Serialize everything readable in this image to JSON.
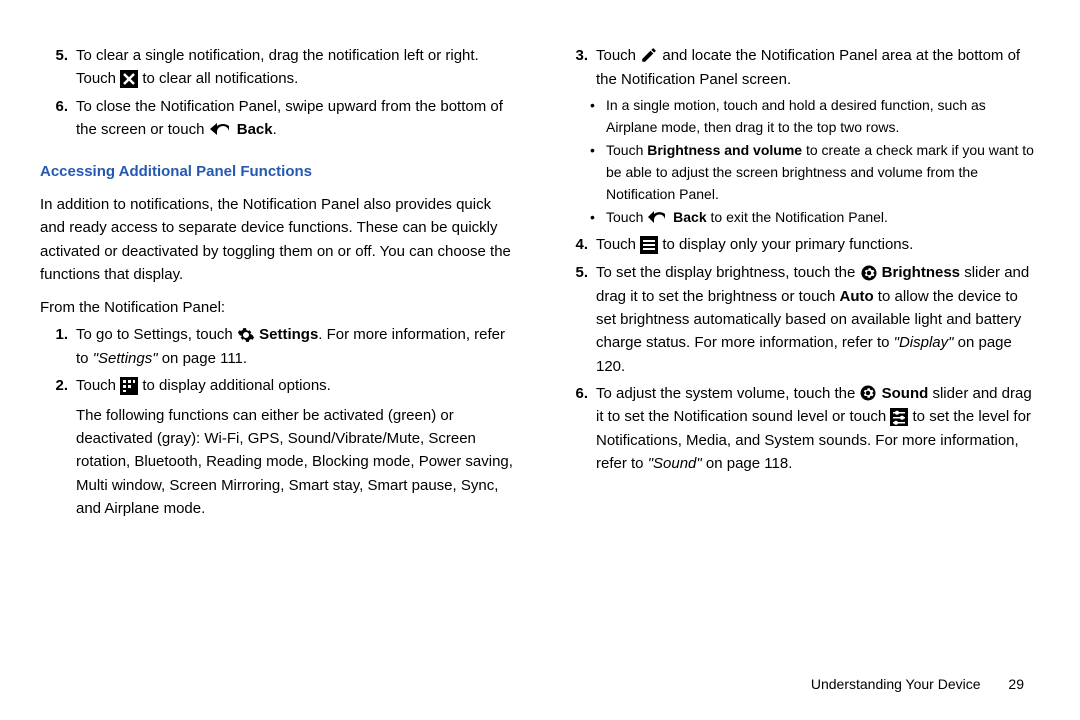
{
  "left": {
    "item5": {
      "num": "5.",
      "text_a": "To clear a single notification, drag the notification left or right. Touch ",
      "text_b": " to clear all notifications."
    },
    "item6": {
      "num": "6.",
      "text_a": "To close the Notification Panel, swipe upward from the bottom of the screen or touch ",
      "back": "Back",
      "text_b": "."
    },
    "heading": "Accessing Additional Panel Functions",
    "intro": "In addition to notifications, the Notification Panel also provides quick and ready access to separate device functions. These can be quickly activated or deactivated by toggling them on or off. You can choose the functions that display.",
    "from": "From the Notification Panel:",
    "s1": {
      "num": "1.",
      "a": "To go to Settings, touch ",
      "settings": "Settings",
      "b": ". For more information, refer to ",
      "ref": "\"Settings\"",
      "c": " on page 111."
    },
    "s2": {
      "num": "2.",
      "a": "Touch ",
      "b": " to display additional options.",
      "follow": "The following functions can either be activated (green) or deactivated (gray): Wi-Fi, GPS, Sound/Vibrate/Mute, Screen rotation, Bluetooth, Reading mode, Blocking mode, Power saving, Multi window, Screen Mirroring, Smart stay, Smart pause, Sync, and Airplane mode."
    }
  },
  "right": {
    "s3": {
      "num": "3.",
      "a": "Touch ",
      "b": " and locate the Notification Panel area at the bottom of the Notification Panel screen."
    },
    "b1": "In a single motion, touch and hold a desired function, such as Airplane mode, then drag it to the top two rows.",
    "b2a": "Touch ",
    "b2bold": "Brightness and volume",
    "b2b": " to create a check mark if you want to be able to adjust the screen brightness and volume from the Notification Panel.",
    "b3a": "Touch ",
    "b3back": "Back",
    "b3b": " to exit the Notification Panel.",
    "s4": {
      "num": "4.",
      "a": "Touch ",
      "b": " to display only your primary functions."
    },
    "s5": {
      "num": "5.",
      "a": "To set the display brightness, touch the ",
      "brightness": "Brightness",
      "b": " slider and drag it to set the brightness or touch ",
      "auto": "Auto",
      "c": " to allow the device to set brightness automatically based on available light and battery charge status. For more information, refer to ",
      "ref": "\"Display\"",
      "d": " on page 120."
    },
    "s6": {
      "num": "6.",
      "a": "To adjust the system volume, touch the ",
      "sound": "Sound",
      "b": " slider and drag it to set the Notification sound level or touch ",
      "c": " to set the level for Notifications, Media, and System sounds. For more information, refer to ",
      "ref": "\"Sound\"",
      "d": " on page 118."
    }
  },
  "footer": {
    "section": "Understanding Your Device",
    "page": "29"
  }
}
